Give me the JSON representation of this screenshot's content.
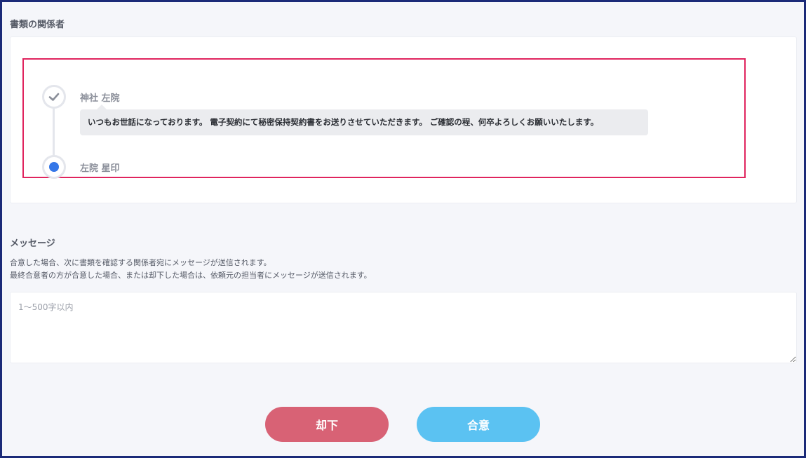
{
  "parties": {
    "title": "書類の関係者",
    "people": [
      {
        "name": "神社 左院",
        "status": "done",
        "comment": "いつもお世話になっております。 電子契約にて秘密保持契約書をお送りさせていただきます。 ご確認の程、何卒よろしくお願いいたします。"
      },
      {
        "name": "左院 星印",
        "status": "current"
      }
    ]
  },
  "message": {
    "title": "メッセージ",
    "description_line1": "合意した場合、次に書類を確認する関係者宛にメッセージが送信されます。",
    "description_line2": "最終合意者の方が合意した場合、または却下した場合は、依頼元の担当者にメッセージが送信されます。",
    "placeholder": "1〜500字以内",
    "value": ""
  },
  "actions": {
    "reject_label": "却下",
    "agree_label": "合意"
  },
  "colors": {
    "highlight": "#e0245e",
    "current_dot": "#3577e8",
    "reject": "#d86275",
    "agree": "#5bc2f2",
    "frame_border": "#1b2a78"
  },
  "icons": {
    "done_step": "check-icon",
    "current_step": "dot-icon"
  }
}
